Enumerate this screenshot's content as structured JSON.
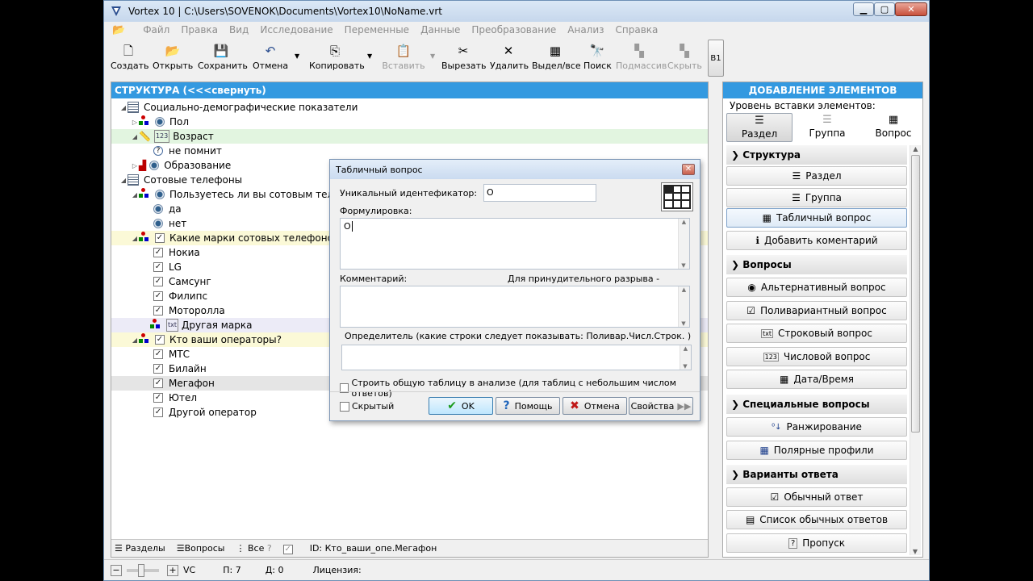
{
  "window": {
    "title": "Vortex 10 | C:\\Users\\SOVENOK\\Documents\\Vortex10\\NoName.vrt"
  },
  "menu": [
    "Файл",
    "Правка",
    "Вид",
    "Исследование",
    "Переменные",
    "Данные",
    "Преобразование",
    "Анализ",
    "Справка"
  ],
  "toolbar": {
    "create": "Создать",
    "open": "Открыть",
    "save": "Сохранить",
    "undo": "Отмена",
    "copy": "Копировать",
    "paste": "Вставить",
    "cut": "Вырезать",
    "delete": "Удалить",
    "select_all": "Выдел/все",
    "search": "Поиск",
    "subarray": "Подмассив",
    "hide": "Скрыть",
    "b1": "B1"
  },
  "left_panel": {
    "header": "СТРУКТУРА (<<<свернуть)",
    "tree": [
      {
        "text": "Социально-демографические показатели"
      },
      {
        "text": "Пол"
      },
      {
        "text": "Возраст"
      },
      {
        "text": "не помнит"
      },
      {
        "text": "Образование"
      },
      {
        "text": "Сотовые телефоны"
      },
      {
        "text": "Пользуетесь ли вы сотовым теле"
      },
      {
        "text": "да"
      },
      {
        "text": "нет"
      },
      {
        "text": "Какие марки сотовых телефонов"
      },
      {
        "text": "Нокиа"
      },
      {
        "text": "LG"
      },
      {
        "text": "Самсунг"
      },
      {
        "text": "Филипс"
      },
      {
        "text": "Моторолла"
      },
      {
        "text": "Другая марка"
      },
      {
        "text": "Кто ваши операторы?"
      },
      {
        "text": "МТС"
      },
      {
        "text": "Билайн"
      },
      {
        "text": "Мегафон"
      },
      {
        "text": "Ютел"
      },
      {
        "text": "Другой оператор"
      }
    ],
    "footer": {
      "sections": "Разделы",
      "questions": "Вопросы",
      "all": "Все",
      "id_text": "ID: Кто_ваши_опе.Мегафон"
    }
  },
  "statusbar": {
    "vc": "VC",
    "p": "П: 7",
    "d": "Д: 0",
    "license": "Лицензия:"
  },
  "dialog": {
    "title": "Табличный вопрос",
    "id_label": "Уникальный идентефикатор:",
    "id_value": "О",
    "formulation_label": "Формулировка:",
    "formulation_value": "О",
    "comment_label": "Комментарий:",
    "hint": "Для принудительного разрыва - Ctrl+Enter",
    "determinant_label": "Определитель (какие строки следует показывать: Поливар.Числ.Строк. )",
    "build_table_label": "Строить  общую таблицу в анализе (для таблиц с небольшим числом ответов)",
    "hidden_label": "Скрытый",
    "ok": "OK",
    "help": "Помощь",
    "cancel": "Отмена",
    "properties": "Свойства"
  },
  "right_panel": {
    "header": "ДОБАВЛЕНИЕ ЭЛЕМЕНТОВ",
    "insert_level_label": "Уровень вставки элементов:",
    "tabs": [
      "Раздел",
      "Группа",
      "Вопрос"
    ],
    "sections": {
      "structure": {
        "title": "Структура",
        "items": [
          "Раздел",
          "Группа",
          "Табличный вопрос",
          "Добавить коментарий"
        ]
      },
      "questions": {
        "title": "Вопросы",
        "items": [
          "Альтернативный вопрос",
          "Поливариантный вопрос",
          "Строковый вопрос",
          "Числовой вопрос",
          "Дата/Время"
        ]
      },
      "special": {
        "title": "Специальные вопросы",
        "items": [
          "Ранжирование",
          "Полярные профили"
        ]
      },
      "answers": {
        "title": "Варианты ответа",
        "items": [
          "Обычный ответ",
          "Список обычных ответов",
          "Пропуск"
        ]
      }
    }
  }
}
